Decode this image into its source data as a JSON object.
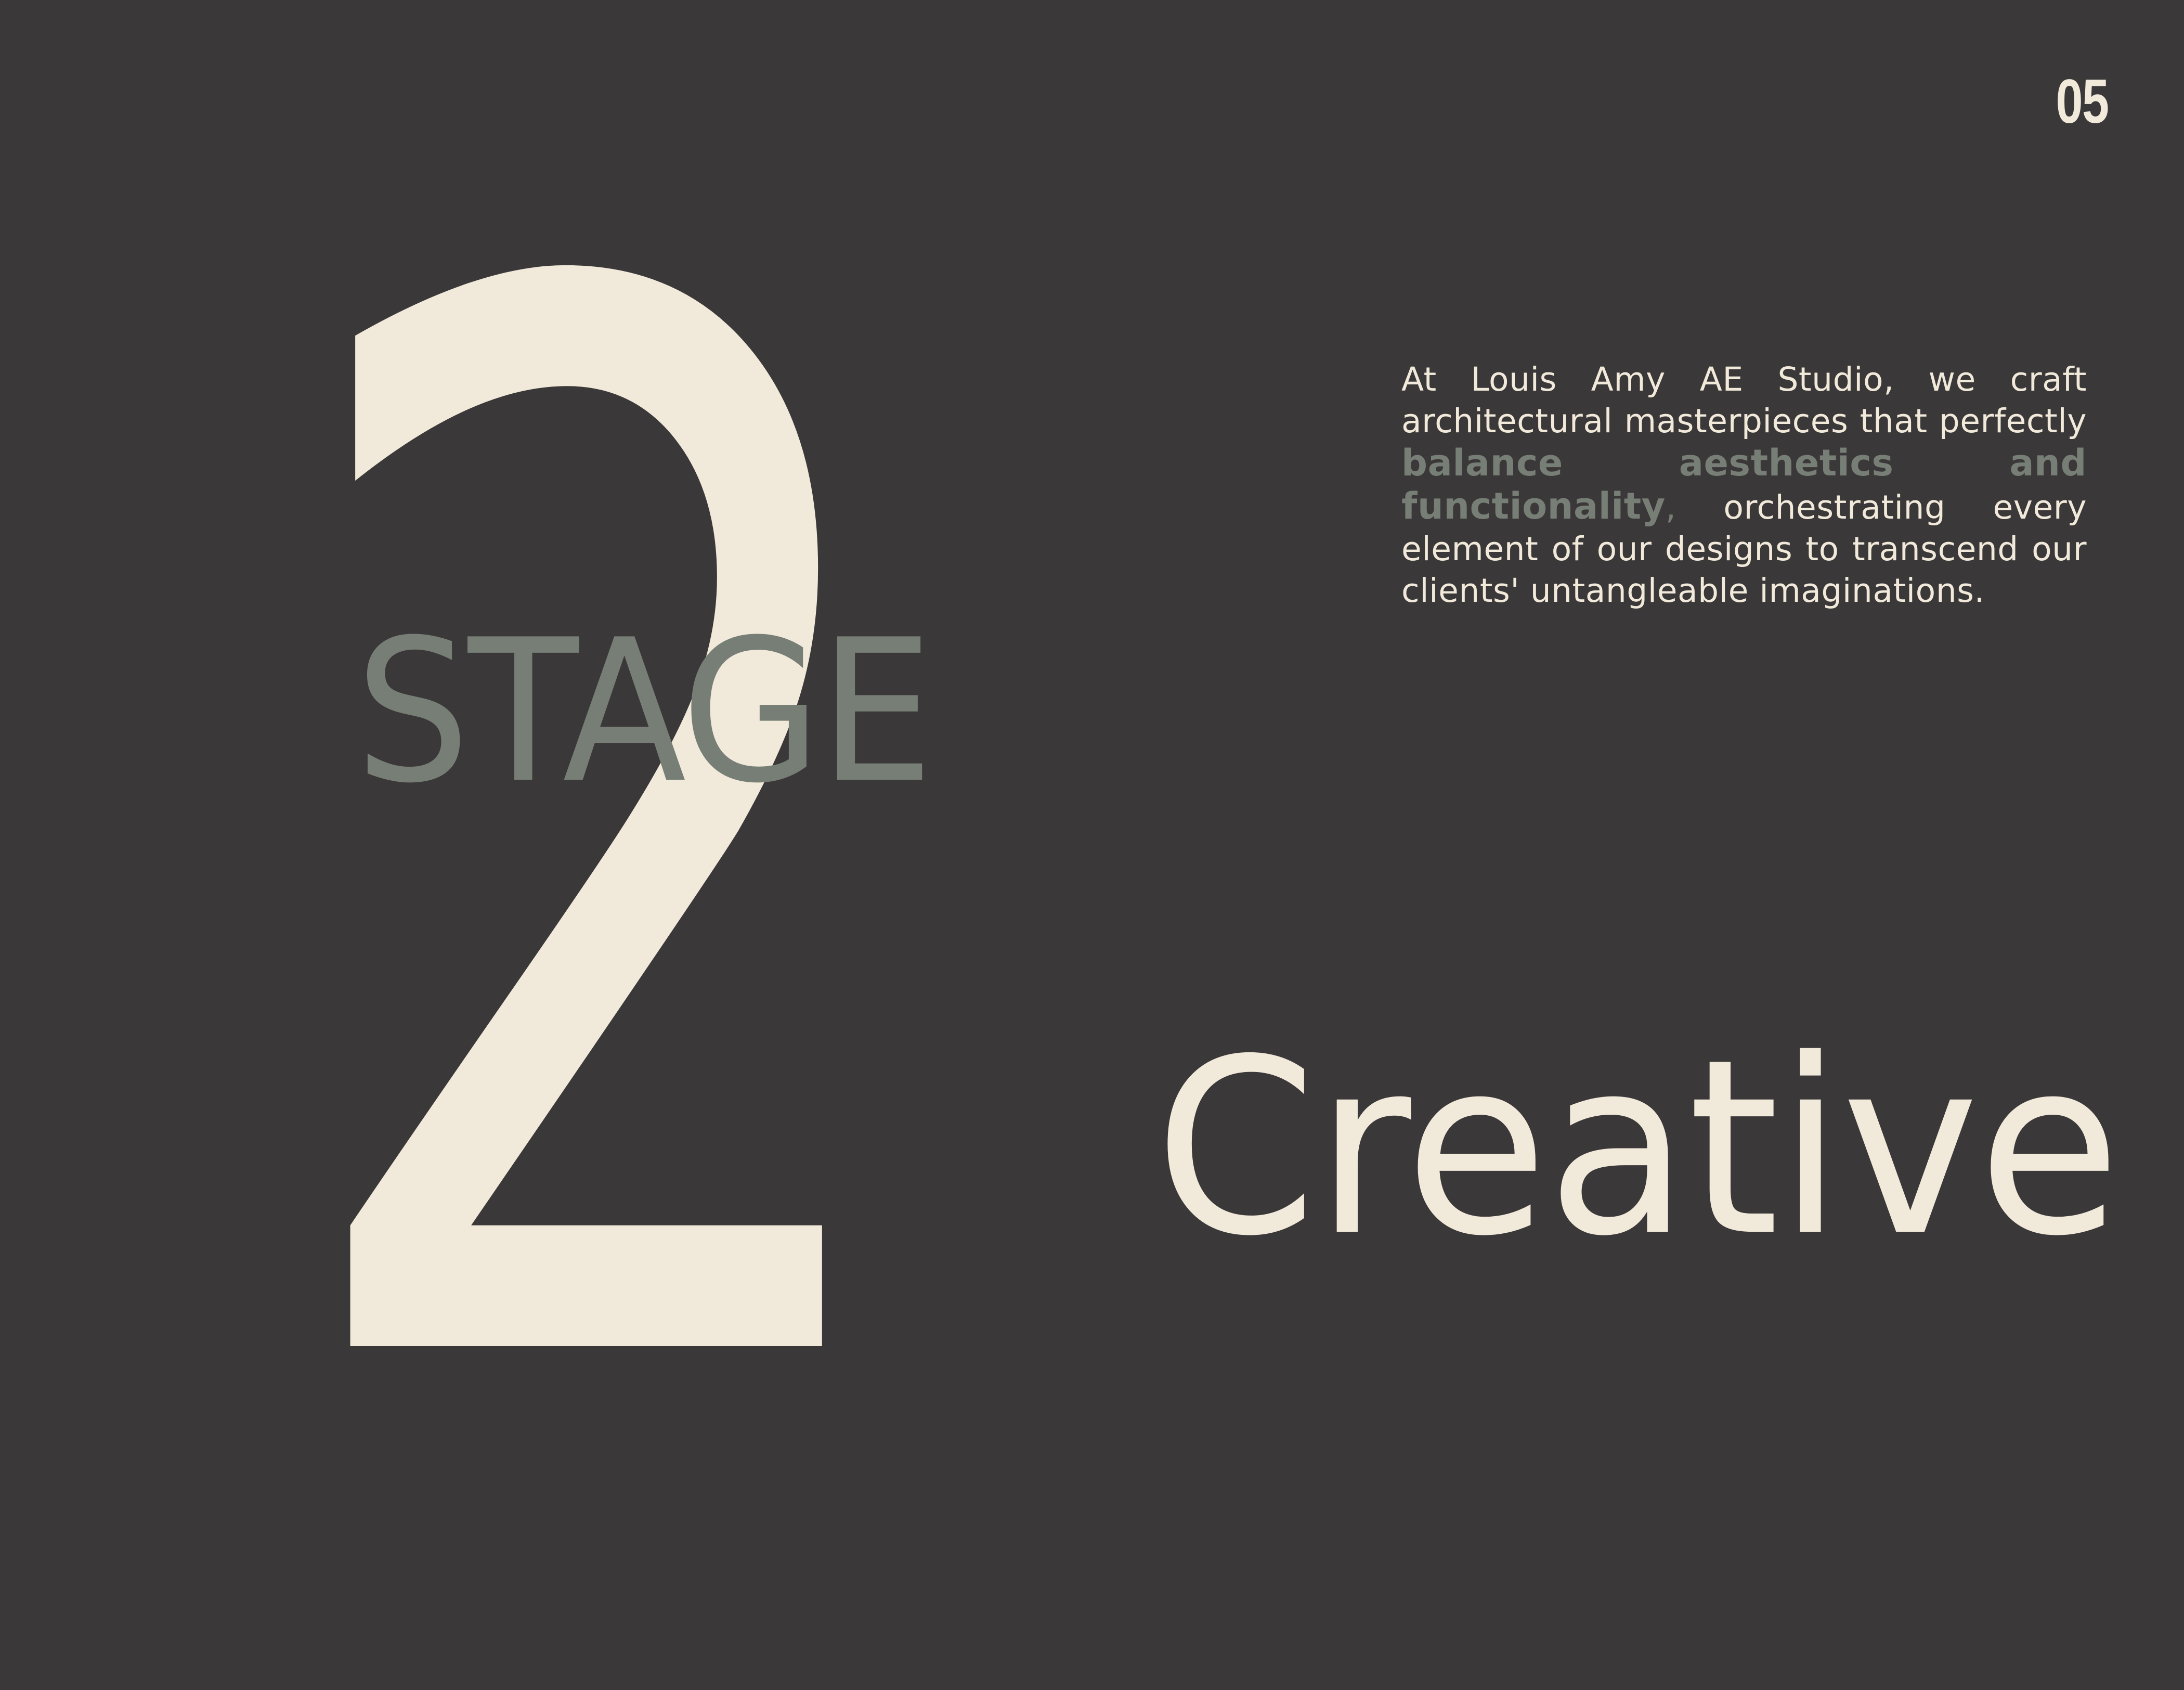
{
  "page_number": "05",
  "big_numeral": "2",
  "stage_label": "STAGE",
  "creative_label": "Creative",
  "description": {
    "part1": "At Louis Amy AE Studio, we craft architectural masterpieces that perfectly ",
    "highlight": "balance aesthetics and functionality",
    "comma": ",",
    "part2": " orchestrating every element of our designs to transcend our clients' untangleable imaginations."
  },
  "colors": {
    "background": "#3b3839",
    "cream": "#f1e9da",
    "sage": "#767e75"
  }
}
